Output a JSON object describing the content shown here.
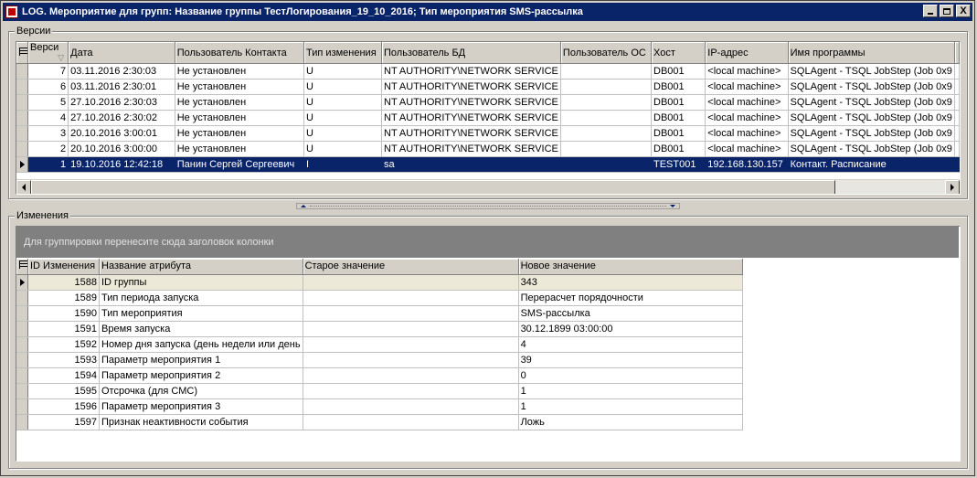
{
  "window": {
    "title": "LOG. Мероприятие для групп: Название группы ТестЛогирования_19_10_2016; Тип мероприятия SMS-рассылка",
    "close_label": "X"
  },
  "versions": {
    "label": "Версии",
    "columns": [
      "Верси",
      "Дата",
      "Пользователь Контакта",
      "Тип изменения",
      "Пользователь БД",
      "Пользователь ОС",
      "Хост",
      "IP-адрес",
      "Имя программы"
    ],
    "rows": [
      [
        "7",
        "03.11.2016 2:30:03",
        "Не установлен",
        "U",
        "NT AUTHORITY\\NETWORK SERVICE",
        "",
        "DB001",
        "<local machine>",
        "SQLAgent - TSQL JobStep (Job 0x9"
      ],
      [
        "6",
        "03.11.2016 2:30:01",
        "Не установлен",
        "U",
        "NT AUTHORITY\\NETWORK SERVICE",
        "",
        "DB001",
        "<local machine>",
        "SQLAgent - TSQL JobStep (Job 0x9"
      ],
      [
        "5",
        "27.10.2016 2:30:03",
        "Не установлен",
        "U",
        "NT AUTHORITY\\NETWORK SERVICE",
        "",
        "DB001",
        "<local machine>",
        "SQLAgent - TSQL JobStep (Job 0x9"
      ],
      [
        "4",
        "27.10.2016 2:30:02",
        "Не установлен",
        "U",
        "NT AUTHORITY\\NETWORK SERVICE",
        "",
        "DB001",
        "<local machine>",
        "SQLAgent - TSQL JobStep (Job 0x9"
      ],
      [
        "3",
        "20.10.2016 3:00:01",
        "Не установлен",
        "U",
        "NT AUTHORITY\\NETWORK SERVICE",
        "",
        "DB001",
        "<local machine>",
        "SQLAgent - TSQL JobStep (Job 0x9"
      ],
      [
        "2",
        "20.10.2016 3:00:00",
        "Не установлен",
        "U",
        "NT AUTHORITY\\NETWORK SERVICE",
        "",
        "DB001",
        "<local machine>",
        "SQLAgent - TSQL JobStep (Job 0x9"
      ],
      [
        "1",
        "19.10.2016 12:42:18",
        "Панин Сергей Сергеевич",
        "I",
        "sa",
        "",
        "TEST001",
        "192.168.130.157",
        "Контакт. Расписание"
      ]
    ],
    "selected_row": 6
  },
  "changes": {
    "label": "Изменения",
    "group_hint": "Для группировки перенесите сюда заголовок колонки",
    "columns": [
      "ID Изменения",
      "Название атрибута",
      "Старое значение",
      "Новое значение"
    ],
    "rows": [
      [
        "1588",
        "ID группы",
        "",
        "343"
      ],
      [
        "1589",
        "Тип периода запуска",
        "",
        "Перерасчет порядочности"
      ],
      [
        "1590",
        "Тип мероприятия",
        "",
        "SMS-рассылка"
      ],
      [
        "1591",
        "Время запуска",
        "",
        "30.12.1899 03:00:00"
      ],
      [
        "1592",
        "Номер дня запуска (день недели или день",
        "",
        "4"
      ],
      [
        "1593",
        "Параметр мероприятия 1",
        "",
        "39"
      ],
      [
        "1594",
        "Параметр мероприятия 2",
        "",
        "0"
      ],
      [
        "1595",
        "Отсрочка (для СМС)",
        "",
        "1"
      ],
      [
        "1596",
        "Параметр мероприятия 3",
        "",
        "1"
      ],
      [
        "1597",
        "Признак неактивности события",
        "",
        "Ложь"
      ]
    ],
    "focused_row": 0
  }
}
